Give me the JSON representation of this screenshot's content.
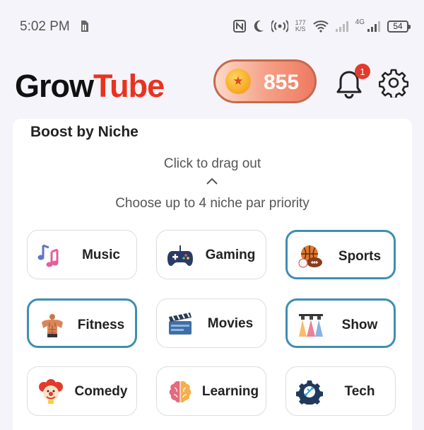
{
  "status_bar": {
    "time": "5:02 PM",
    "net_speed_value": "177",
    "net_speed_unit": "K/S",
    "network_type": "4G",
    "battery": "54"
  },
  "header": {
    "logo_part1": "Grow",
    "logo_part2": "Tube",
    "coins": "855",
    "notification_count": "1"
  },
  "card": {
    "title": "Boost by Niche",
    "drag_hint": "Click to drag out",
    "choose_hint": "Choose up to 4 niche par priority"
  },
  "niches": [
    {
      "label": "Music",
      "icon": "music-notes-icon",
      "selected": false
    },
    {
      "label": "Gaming",
      "icon": "gamepad-icon",
      "selected": false
    },
    {
      "label": "Sports",
      "icon": "sports-balls-icon",
      "selected": true
    },
    {
      "label": "Fitness",
      "icon": "muscle-torso-icon",
      "selected": true
    },
    {
      "label": "Movies",
      "icon": "clapperboard-icon",
      "selected": false
    },
    {
      "label": "Show",
      "icon": "stage-lights-icon",
      "selected": true
    },
    {
      "label": "Comedy",
      "icon": "clown-icon",
      "selected": false
    },
    {
      "label": "Learning",
      "icon": "brain-icon",
      "selected": false
    },
    {
      "label": "Tech",
      "icon": "tech-gear-icon",
      "selected": false
    }
  ],
  "colors": {
    "accent_selected": "#3d8fb1",
    "logo_red": "#e8331f",
    "coin_pill": "#f59d83"
  }
}
